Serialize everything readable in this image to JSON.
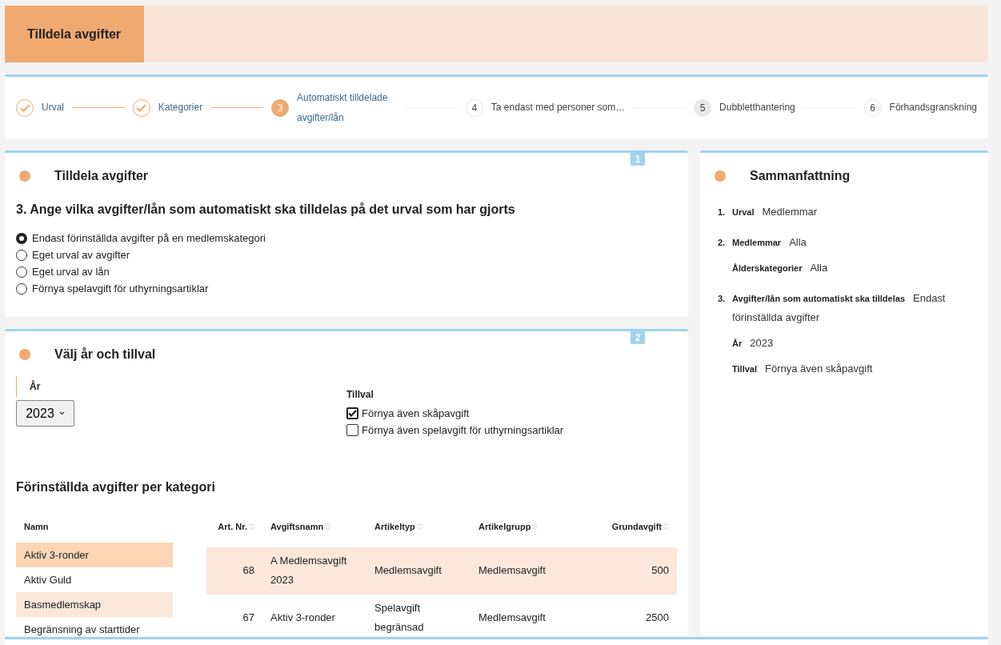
{
  "header": {
    "title": "Tilldela avgifter"
  },
  "steps": [
    {
      "label": "Urval",
      "done": true,
      "selected": false,
      "highlighted": false
    },
    {
      "label": "Kategorier",
      "done": true,
      "selected": false,
      "highlighted": false
    },
    {
      "marker": "3",
      "label": "Automatiskt tilldelade avgifter/lån",
      "done": false,
      "selected": true,
      "highlighted": false
    },
    {
      "marker": "4",
      "label": "Ta endast med personer som…",
      "done": false,
      "selected": false,
      "highlighted": false
    },
    {
      "marker": "5",
      "label": "Dubbletthantering",
      "done": false,
      "selected": false,
      "highlighted": true
    },
    {
      "marker": "6",
      "label": "Förhandsgranskning",
      "done": false,
      "selected": false,
      "highlighted": false
    }
  ],
  "section1": {
    "badge": "1",
    "title": "Tilldela avgifter",
    "question": "3. Ange vilka avgifter/lån som automatiskt ska tilldelas på det urval som har gjorts",
    "options": [
      {
        "label": "Endast förinställda avgifter på en medlemskategori",
        "selected": true
      },
      {
        "label": "Eget urval av avgifter",
        "selected": false
      },
      {
        "label": "Eget urval av lån",
        "selected": false
      },
      {
        "label": "Förnya spelavgift för uthyrningsartiklar",
        "selected": false
      }
    ]
  },
  "section2": {
    "badge": "2",
    "title": "Välj år och tillval",
    "year_label": "År",
    "year_value": "2023",
    "addons_label": "Tillval",
    "addons": [
      {
        "label": "Förnya även skåpavgift",
        "checked": true
      },
      {
        "label": "Förnya även spelavgift för uthyrningsartiklar",
        "checked": false
      }
    ],
    "table_title": "Förinställda avgifter per kategori",
    "categories_header": "Namn",
    "categories": [
      {
        "name": "Aktiv 3-ronder",
        "selected": true
      },
      {
        "name": "Aktiv Guld",
        "selected": false
      },
      {
        "name": "Basmedlemskap",
        "selected": false
      },
      {
        "name": "Begränsning av starttider",
        "selected": false
      }
    ],
    "table": {
      "columns": [
        "Art. Nr.",
        "Avgiftsnamn",
        "Artikeltyp",
        "Artikelgrupp",
        "Grundavgift"
      ],
      "rows": [
        [
          "68",
          "A Medlemsavgift 2023",
          "Medlemsavgift",
          "Medlemsavgift",
          "500"
        ],
        [
          "67",
          "Aktiv 3-ronder",
          "Spelavgift begränsad",
          "Medlemsavgift",
          "2500"
        ]
      ]
    }
  },
  "summary": {
    "title": "Sammanfattning",
    "items": [
      {
        "number": "1.",
        "entries": [
          {
            "label": "Urval",
            "value": "Medlemmar"
          }
        ]
      },
      {
        "number": "2.",
        "entries": [
          {
            "label": "Medlemmar",
            "value": "Alla"
          },
          {
            "label": "Ålderskategorier",
            "value": "Alla"
          }
        ]
      },
      {
        "number": "3.",
        "entries": [
          {
            "label": "Avgifter/lån som automatiskt ska tilldelas",
            "value": "Endast förinställda avgifter"
          },
          {
            "label": "År",
            "value": "2023"
          },
          {
            "label": "Tillval",
            "value": "Förnya även skåpavgift"
          }
        ]
      }
    ]
  }
}
